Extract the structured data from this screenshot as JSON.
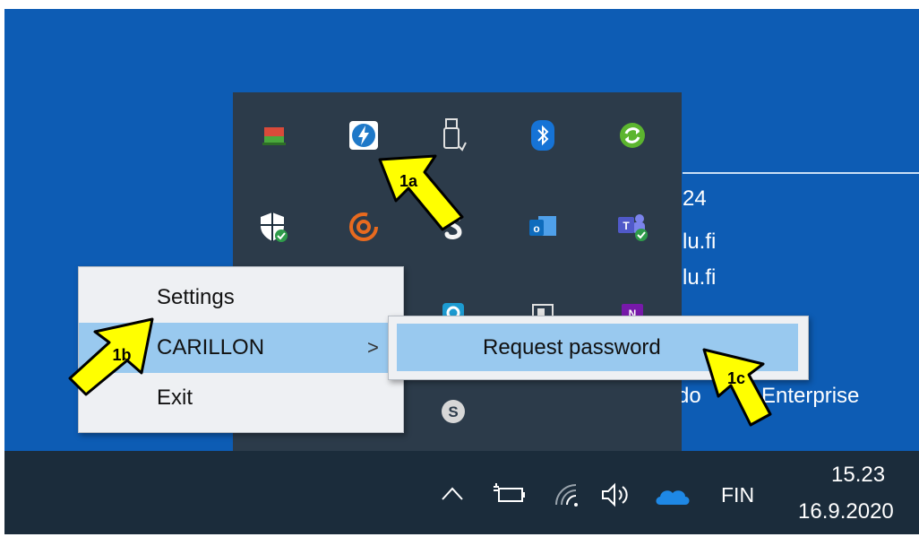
{
  "desktop_text": {
    "line1": "24",
    "line2": "lu.fi",
    "line3": "lu.fi",
    "line4": "do",
    "line5": "0 Enterprise"
  },
  "tray_icons": [
    "network-drive-icon",
    "thunderbolt-icon",
    "usb-eject-icon",
    "bluetooth-icon",
    "sync-icon",
    "windows-security-icon",
    "carillon-icon",
    "s-app-icon",
    "outlook-icon",
    "teams-icon",
    "skype-icon"
  ],
  "context_menu": {
    "items": [
      {
        "label": "Settings"
      },
      {
        "label": "CARILLON",
        "arrow": ">"
      },
      {
        "label": "Exit"
      }
    ]
  },
  "submenu": {
    "items": [
      {
        "label": "Request password"
      }
    ]
  },
  "callouts": {
    "a": "1a",
    "b": "1b",
    "c": "1c"
  },
  "taskbar": {
    "language": "FIN",
    "time": "15.23",
    "date": "16.9.2020"
  },
  "colors": {
    "desktop": "#0d5cb4",
    "taskbar": "#1b2c3b",
    "tray_overflow": "#2c3b4a",
    "menu_bg": "#eef0f3",
    "highlight": "#99c9ef",
    "callout_fill": "#ffff00"
  }
}
